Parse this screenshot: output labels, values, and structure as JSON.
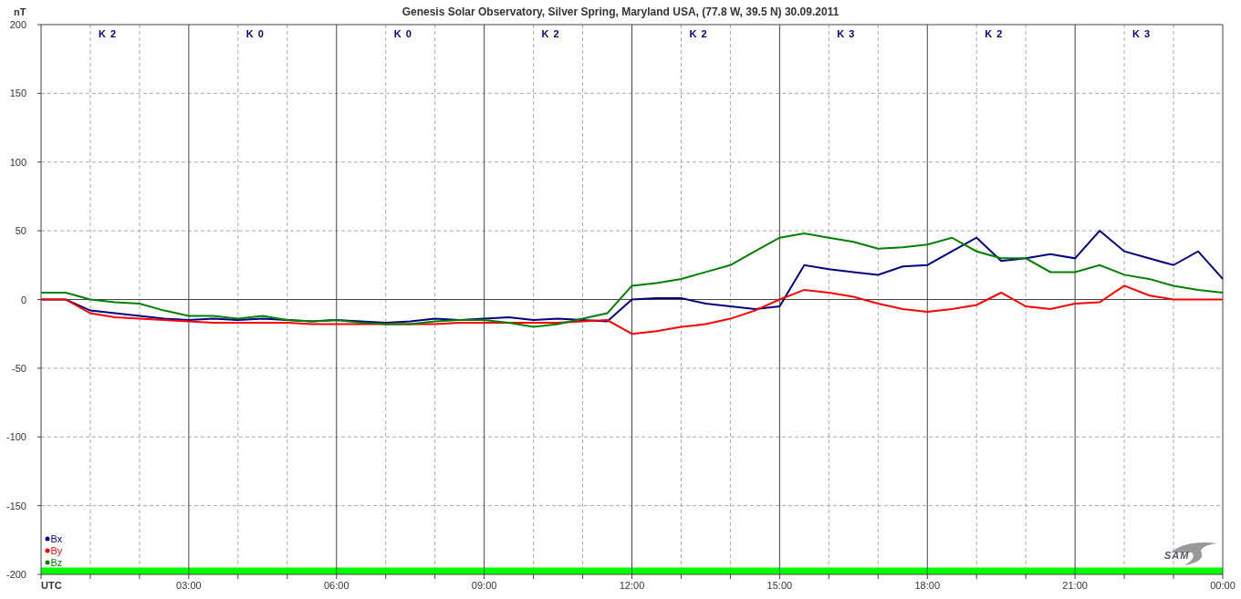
{
  "chart": {
    "chart_data": {
      "type": "line",
      "title": "Genesis Solar Observatory, Silver Spring, Maryland USA, (77.8 W, 39.5 N)  30.09.2011",
      "ylabel": "nT",
      "xlim": [
        0,
        24
      ],
      "ylim": [
        -200,
        200
      ],
      "yticks": [
        200,
        150,
        100,
        50,
        0,
        -50,
        -100,
        -150,
        -200
      ],
      "xticks": [
        {
          "value": 0,
          "label": "UTC"
        },
        {
          "value": 3,
          "label": "03:00"
        },
        {
          "value": 6,
          "label": "06:00"
        },
        {
          "value": 9,
          "label": "09:00"
        },
        {
          "value": 12,
          "label": "12:00"
        },
        {
          "value": 15,
          "label": "15:00"
        },
        {
          "value": 18,
          "label": "18:00"
        },
        {
          "value": 21,
          "label": "21:00"
        },
        {
          "value": 24,
          "label": "00:00"
        }
      ],
      "x": [
        0,
        0.5,
        1,
        1.5,
        2,
        2.5,
        3,
        3.5,
        4,
        4.5,
        5,
        5.5,
        6,
        6.5,
        7,
        7.5,
        8,
        8.5,
        9,
        9.5,
        10,
        10.5,
        11,
        11.5,
        12,
        12.5,
        13,
        13.5,
        14,
        14.5,
        15,
        15.5,
        16,
        16.5,
        17,
        17.5,
        18,
        18.5,
        19,
        19.5,
        20,
        20.5,
        21,
        21.5,
        22,
        22.5,
        23,
        23.5,
        24
      ],
      "series": [
        {
          "name": "Bx",
          "color": "#000080",
          "values": [
            0,
            0,
            -8,
            -10,
            -12,
            -14,
            -15,
            -14,
            -15,
            -14,
            -15,
            -16,
            -15,
            -16,
            -17,
            -16,
            -14,
            -15,
            -14,
            -13,
            -15,
            -14,
            -15,
            -16,
            0,
            1,
            1,
            -3,
            -5,
            -7,
            -5,
            25,
            22,
            20,
            18,
            24,
            25,
            35,
            45,
            28,
            30,
            33,
            30,
            50,
            35,
            30,
            25,
            35,
            15
          ]
        },
        {
          "name": "By",
          "color": "#ff0000",
          "values": [
            0,
            0,
            -10,
            -13,
            -14,
            -15,
            -16,
            -17,
            -17,
            -17,
            -17,
            -18,
            -18,
            -18,
            -18,
            -18,
            -18,
            -17,
            -17,
            -17,
            -17,
            -17,
            -16,
            -15,
            -25,
            -23,
            -20,
            -18,
            -14,
            -8,
            0,
            7,
            5,
            2,
            -3,
            -7,
            -9,
            -7,
            -4,
            5,
            -5,
            -7,
            -3,
            -2,
            10,
            3,
            0,
            0,
            0
          ]
        },
        {
          "name": "Bz",
          "color": "#008000",
          "values": [
            5,
            5,
            0,
            -2,
            -3,
            -8,
            -12,
            -12,
            -14,
            -12,
            -15,
            -16,
            -15,
            -17,
            -18,
            -18,
            -16,
            -15,
            -15,
            -17,
            -20,
            -18,
            -14,
            -10,
            10,
            12,
            15,
            20,
            25,
            35,
            45,
            48,
            45,
            42,
            37,
            38,
            40,
            45,
            35,
            30,
            30,
            20,
            20,
            25,
            18,
            15,
            10,
            7,
            5
          ]
        }
      ],
      "grid": true,
      "bands": [
        {
          "axis": "y",
          "from": -200,
          "to": -195,
          "color": "#00ff00"
        }
      ],
      "annotations": [
        "K 2",
        "K 0",
        "K 0",
        "K 2",
        "K 2",
        "K 3",
        "K 2",
        "K 3"
      ]
    },
    "logo": "SAM"
  }
}
